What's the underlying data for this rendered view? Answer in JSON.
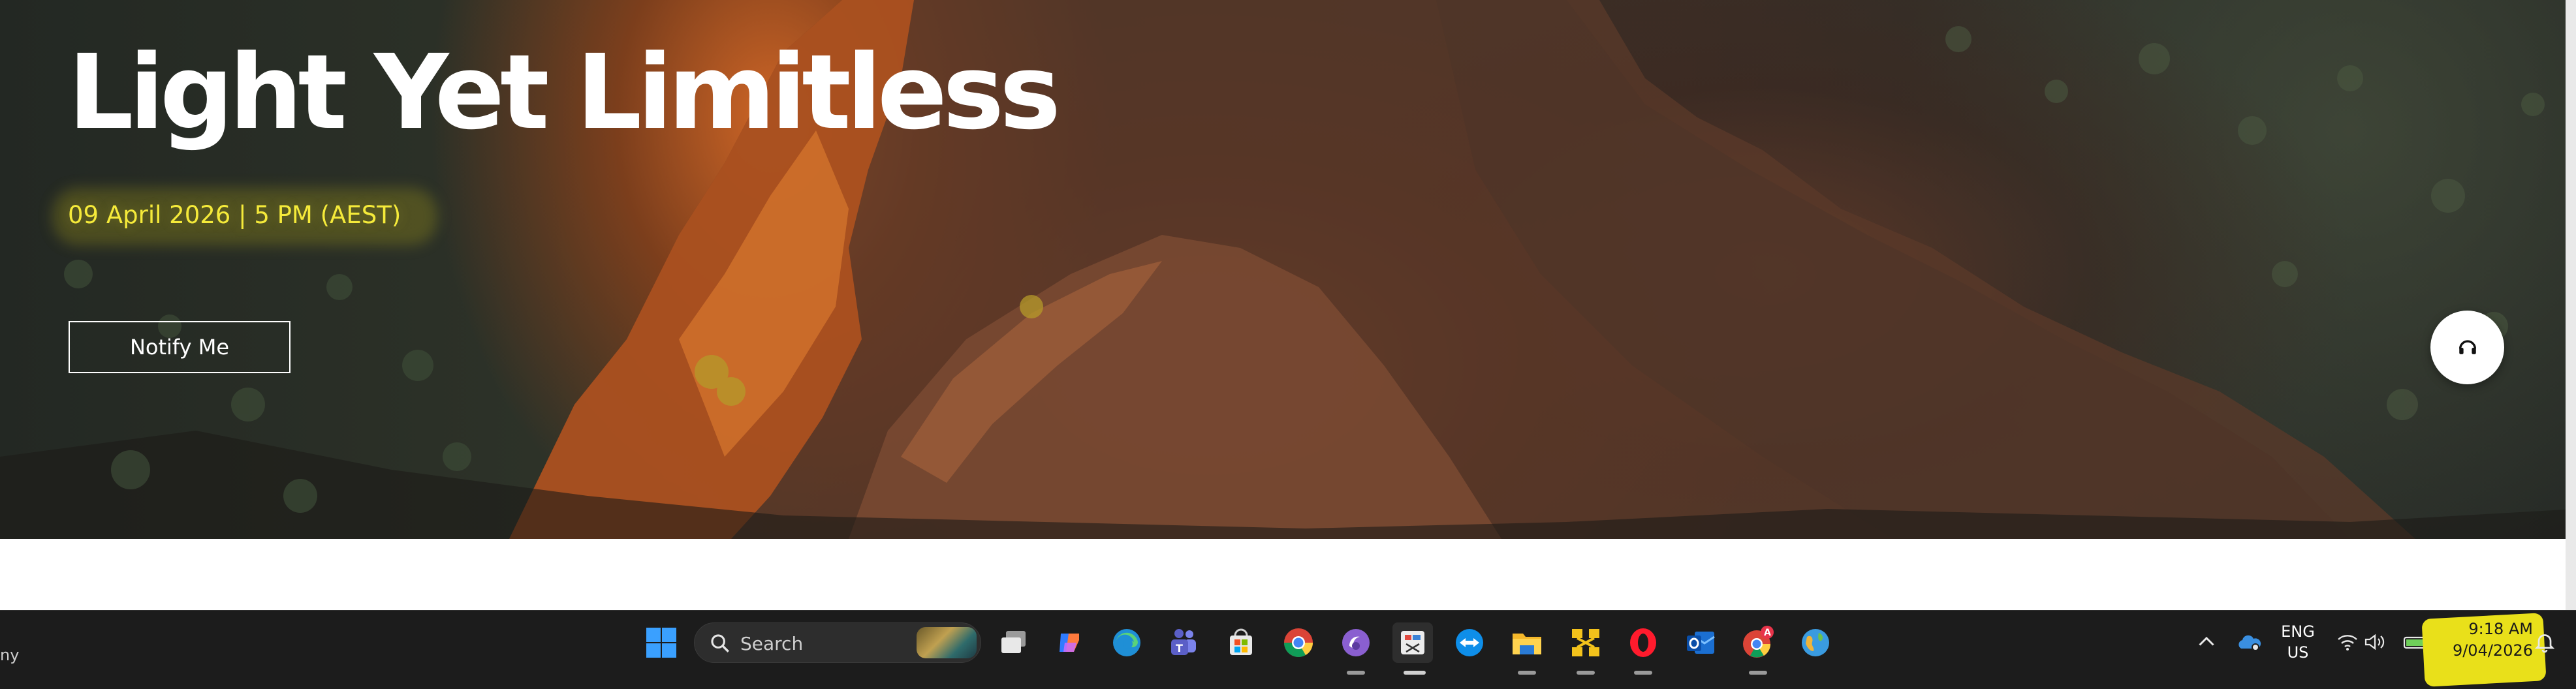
{
  "hero": {
    "title": "Light Yet Limitless",
    "date": "09 April 2026 | 5 PM (AEST)",
    "notify_label": "Notify Me",
    "support_icon": "headset-icon"
  },
  "taskbar": {
    "left_fragment": "ny",
    "search_placeholder": "Search",
    "pinned_apps": [
      {
        "name": "task-view-icon"
      },
      {
        "name": "copilot-icon"
      },
      {
        "name": "edge-icon"
      },
      {
        "name": "teams-icon"
      },
      {
        "name": "microsoft-store-icon"
      },
      {
        "name": "chrome-icon"
      },
      {
        "name": "torrent-icon"
      },
      {
        "name": "snipping-tool-icon"
      },
      {
        "name": "teamviewer-icon"
      },
      {
        "name": "file-explorer-icon"
      },
      {
        "name": "network-tool-icon"
      },
      {
        "name": "opera-icon"
      },
      {
        "name": "outlook-icon"
      },
      {
        "name": "chrome-profile-icon"
      },
      {
        "name": "earth-app-icon"
      }
    ],
    "tray": {
      "lang_line1": "ENG",
      "lang_line2": "US",
      "time": "9:18 AM",
      "date": "9/04/2026"
    }
  },
  "colors": {
    "date_yellow": "#f5ea3a",
    "highlight_yellow": "#e9e01a",
    "taskbar_bg": "#1c1c1c"
  }
}
